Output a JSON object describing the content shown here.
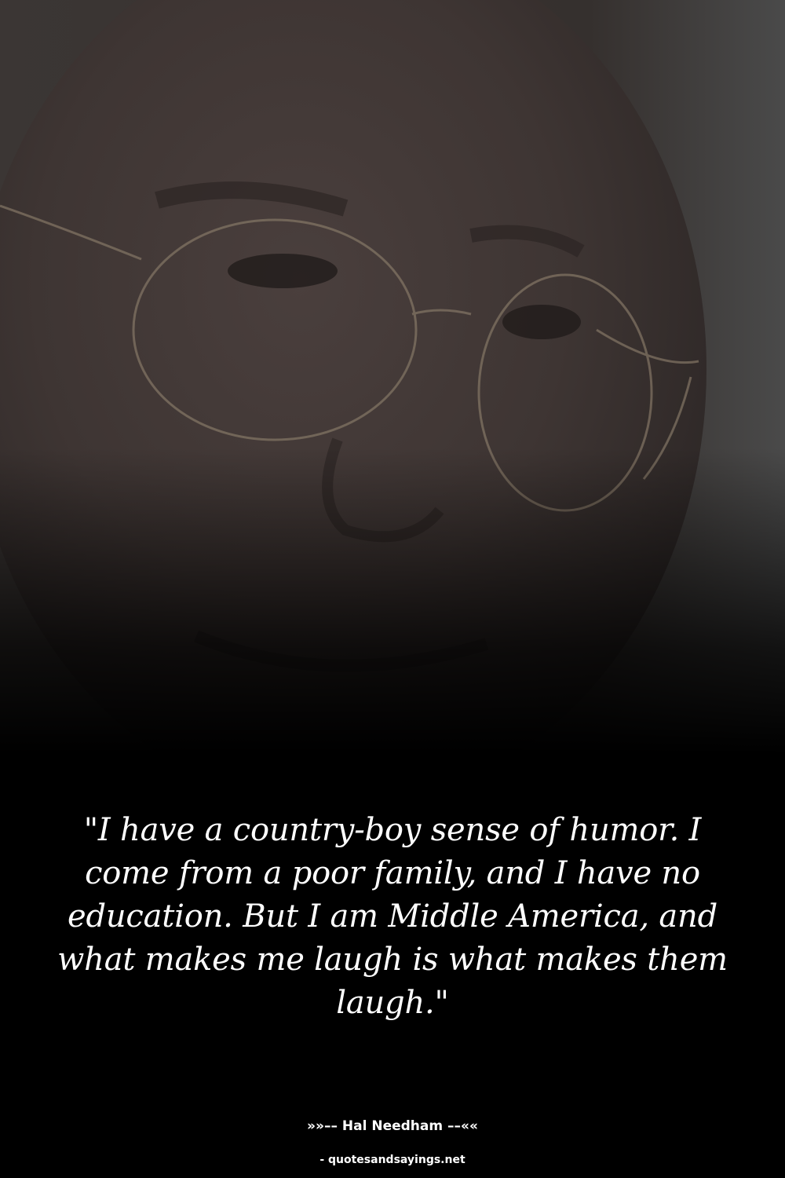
{
  "quote": {
    "text": "\"I have a country-boy sense of humor. I come from a poor family, and I have no education. But I am Middle America, and what makes me laugh is what makes them laugh.\""
  },
  "attribution": {
    "author_line": "»»–– Hal Needham ––««",
    "source_line": "- quotesandsayings.net"
  },
  "colors": {
    "background_bottom": "#000000",
    "background_top": "#3a3a3a",
    "text": "#ffffff"
  }
}
